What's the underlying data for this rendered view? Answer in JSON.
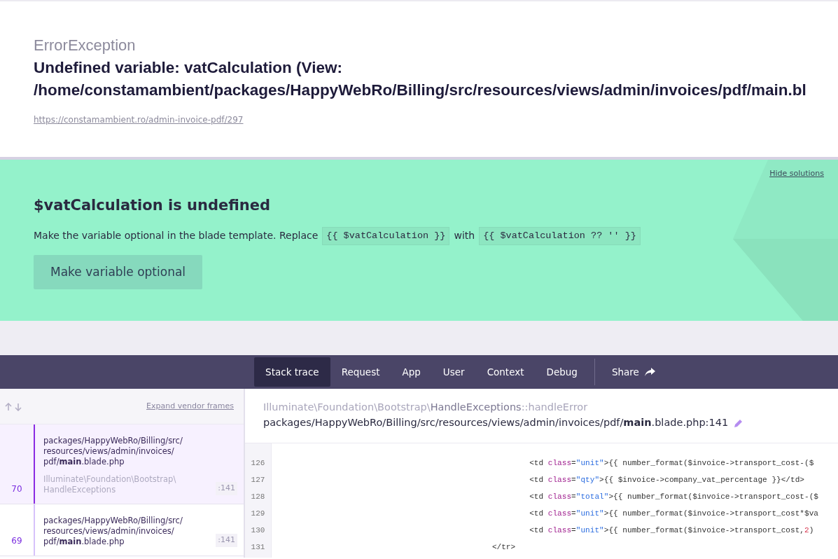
{
  "header": {
    "exception_class": "ErrorException",
    "message": "Undefined variable: vatCalculation (View: /home/constamambient/packages/HappyWebRo/Billing/src/resources/views/admin/invoices/pdf/main.bl",
    "url": "https://constamambient.ro/admin-invoice-pdf/297"
  },
  "solution": {
    "hide_link": "Hide solutions",
    "title": "$vatCalculation is undefined",
    "description": [
      {
        "kind": "text",
        "text": "Make the variable optional in the blade template. Replace"
      },
      {
        "kind": "code",
        "text": "{{ $vatCalculation }}"
      },
      {
        "kind": "text",
        "text": "with"
      },
      {
        "kind": "code",
        "text": "{{ $vatCalculation ?? '' }}"
      }
    ],
    "button": "Make variable optional"
  },
  "tabs": [
    {
      "label": "Stack trace",
      "selected": true
    },
    {
      "label": "Request",
      "selected": false
    },
    {
      "label": "App",
      "selected": false
    },
    {
      "label": "User",
      "selected": false
    },
    {
      "label": "Context",
      "selected": false
    },
    {
      "label": "Debug",
      "selected": false
    }
  ],
  "share": "Share",
  "frames_toolbar": {
    "expand_link": "Expand vendor frames"
  },
  "frames": [
    {
      "number": "70",
      "path": "packages/HappyWebRo/Billing/src/resources/views/admin/invoices/pdf/",
      "file": "main",
      "ext": ".blade.php",
      "class": "Illuminate\\Foundation\\Bootstrap\\HandleExceptions",
      "line": ":141",
      "selected": true
    },
    {
      "number": "69",
      "path": "packages/HappyWebRo/Billing/src/resources/views/admin/invoices/pdf/",
      "file": "main",
      "ext": ".blade.php",
      "line": ":141",
      "selected": false
    }
  ],
  "detail": {
    "class_path": "Illuminate\\Foundation\\Bootstrap\\",
    "class_name": "HandleExceptions",
    "method": "::handleError",
    "file_path": "packages/HappyWebRo/Billing/src/resources/views/admin/invoices/pdf/",
    "file_name": "main",
    "file_rest": ".blade.php:141"
  },
  "code": [
    {
      "number": "126",
      "tokens": [
        {
          "kind": "plain",
          "text": "                                                       <td "
        },
        {
          "kind": "attr",
          "text": "class"
        },
        {
          "kind": "plain",
          "text": "="
        },
        {
          "kind": "string",
          "text": "\"unit\""
        },
        {
          "kind": "plain",
          "text": ">{{ number_format($invoice->transport_cost-($"
        }
      ]
    },
    {
      "number": "127",
      "tokens": [
        {
          "kind": "plain",
          "text": "                                                       <td "
        },
        {
          "kind": "attr",
          "text": "class"
        },
        {
          "kind": "plain",
          "text": "="
        },
        {
          "kind": "string",
          "text": "\"qty\""
        },
        {
          "kind": "plain",
          "text": ">{{ $invoice->company_vat_percentage }}</td>"
        }
      ]
    },
    {
      "number": "128",
      "tokens": [
        {
          "kind": "plain",
          "text": "                                                       <td "
        },
        {
          "kind": "attr",
          "text": "class"
        },
        {
          "kind": "plain",
          "text": "="
        },
        {
          "kind": "string",
          "text": "\"total\""
        },
        {
          "kind": "plain",
          "text": ">{{ number_format($invoice->transport_cost-($"
        }
      ]
    },
    {
      "number": "129",
      "tokens": [
        {
          "kind": "plain",
          "text": "                                                       <td "
        },
        {
          "kind": "attr",
          "text": "class"
        },
        {
          "kind": "plain",
          "text": "="
        },
        {
          "kind": "string",
          "text": "\"unit\""
        },
        {
          "kind": "plain",
          "text": ">{{ number_format($invoice->transport_cost*$va"
        }
      ]
    },
    {
      "number": "130",
      "tokens": [
        {
          "kind": "plain",
          "text": "                                                       <td "
        },
        {
          "kind": "attr",
          "text": "class"
        },
        {
          "kind": "plain",
          "text": "="
        },
        {
          "kind": "string",
          "text": "\"unit\""
        },
        {
          "kind": "plain",
          "text": ">{{ number_format($invoice->transport_cost,"
        },
        {
          "kind": "number",
          "text": "2"
        },
        {
          "kind": "plain",
          "text": ")"
        }
      ]
    },
    {
      "number": "131",
      "tokens": [
        {
          "kind": "plain",
          "text": "                                               </tr>"
        }
      ]
    }
  ]
}
